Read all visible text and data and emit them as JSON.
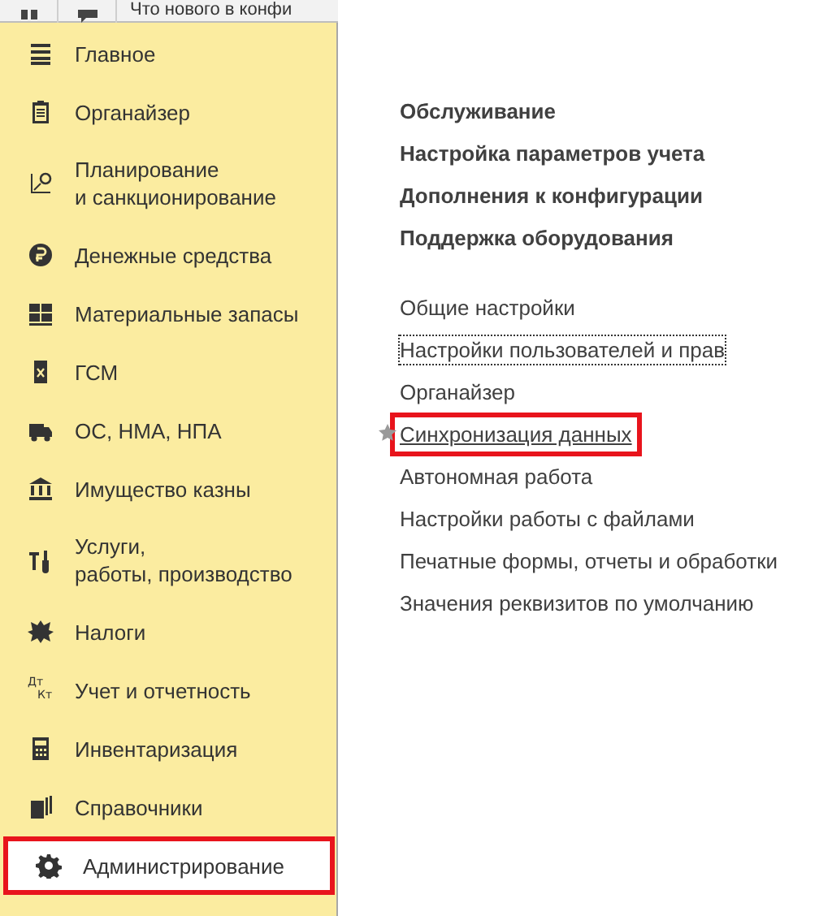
{
  "top_bar": {
    "tab_title": "Что нового в конфи"
  },
  "sidebar": {
    "items": [
      {
        "label": "Главное",
        "selected": false,
        "highlighted": false
      },
      {
        "label": "Органайзер",
        "selected": false,
        "highlighted": false
      },
      {
        "label": "Планирование\nи санкционирование",
        "selected": false,
        "highlighted": false
      },
      {
        "label": "Денежные средства",
        "selected": false,
        "highlighted": false
      },
      {
        "label": "Материальные запасы",
        "selected": false,
        "highlighted": false
      },
      {
        "label": "ГСМ",
        "selected": false,
        "highlighted": false
      },
      {
        "label": "ОС, НМА, НПА",
        "selected": false,
        "highlighted": false
      },
      {
        "label": "Имущество казны",
        "selected": false,
        "highlighted": false
      },
      {
        "label": "Услуги,\nработы, производство",
        "selected": false,
        "highlighted": false
      },
      {
        "label": "Налоги",
        "selected": false,
        "highlighted": false
      },
      {
        "label": "Учет и отчетность",
        "icon_text": [
          "Дт",
          "Кт"
        ],
        "selected": false,
        "highlighted": false
      },
      {
        "label": "Инвентаризация",
        "selected": false,
        "highlighted": false
      },
      {
        "label": "Справочники",
        "selected": false,
        "highlighted": false
      },
      {
        "label": "Администрирование",
        "selected": true,
        "highlighted": true
      }
    ]
  },
  "sections": [
    "Обслуживание",
    "Настройка параметров учета",
    "Дополнения к конфигурации",
    "Поддержка оборудования"
  ],
  "commands": [
    {
      "label": "Общие настройки",
      "favorite": false,
      "focused": false,
      "highlighted": false
    },
    {
      "label": "Настройки пользователей и прав",
      "favorite": false,
      "focused": true,
      "highlighted": false
    },
    {
      "label": "Органайзер",
      "favorite": false,
      "focused": false,
      "highlighted": false
    },
    {
      "label": "Синхронизация данных",
      "favorite": true,
      "focused": false,
      "highlighted": true
    },
    {
      "label": "Автономная работа",
      "favorite": false,
      "focused": false,
      "highlighted": false
    },
    {
      "label": "Настройки работы с файлами",
      "favorite": false,
      "focused": false,
      "highlighted": false
    },
    {
      "label": "Печатные формы, отчеты и обработки",
      "favorite": false,
      "focused": false,
      "highlighted": false
    },
    {
      "label": "Значения реквизитов по умолчанию",
      "favorite": false,
      "focused": false,
      "highlighted": false
    }
  ]
}
